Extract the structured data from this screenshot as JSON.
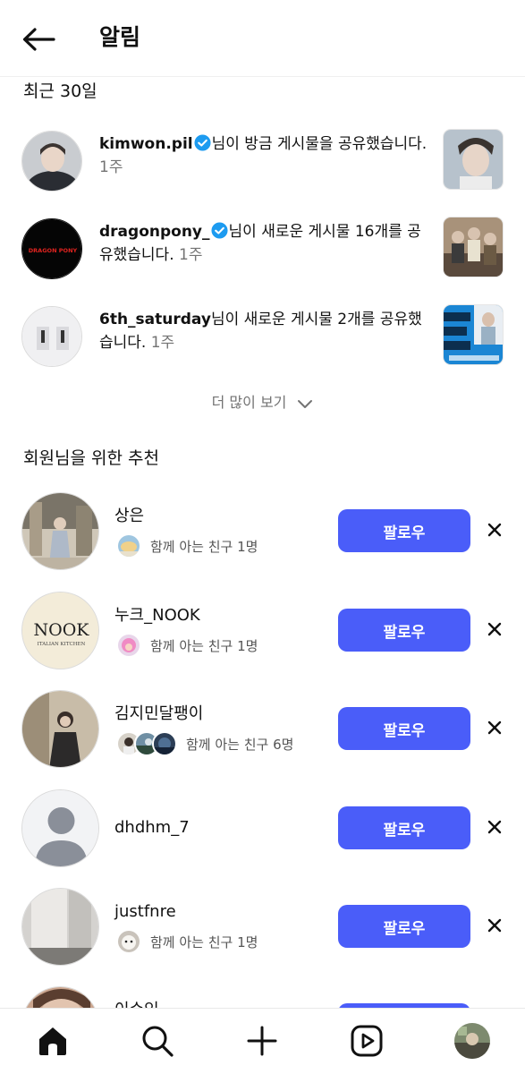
{
  "header": {
    "title": "알림",
    "back_icon": "arrow-left-icon"
  },
  "recent": {
    "heading": "최근 30일",
    "items": [
      {
        "username": "kimwon.pil",
        "verified": true,
        "message": "님이 방금 게시물을 공유했습니다.",
        "time": "1주"
      },
      {
        "username": "dragonpony_",
        "verified": true,
        "message": "님이 새로운 게시물 16개를 공유했습니다.",
        "time": "1주",
        "avatar_text": "DRAGON PONY"
      },
      {
        "username": "6th_saturday",
        "verified": false,
        "message": "님이 새로운 게시물 2개를 공유했습니다.",
        "time": "1주"
      }
    ],
    "see_more": "더 많이 보기"
  },
  "suggestions": {
    "heading": "회원님을 위한 추천",
    "follow_label": "팔로우",
    "items": [
      {
        "name": "상은",
        "mutual": "함께 아는 친구 1명"
      },
      {
        "name": "누크_NOOK",
        "mutual": "함께 아는 친구 1명",
        "avatar_logo": "NOOK",
        "avatar_sub": "ITALIAN KITCHEN"
      },
      {
        "name": "김지민달팽이",
        "mutual": "함께 아는 친구 6명"
      },
      {
        "name": "dhdhm_7",
        "mutual": ""
      },
      {
        "name": "justfnre",
        "mutual": "함께 아는 친구 1명"
      },
      {
        "name": "이수인",
        "mutual": ""
      }
    ]
  },
  "bottom_nav": {
    "items": [
      "home-icon",
      "search-icon",
      "plus-icon",
      "reels-icon",
      "profile-avatar"
    ]
  },
  "colors": {
    "accent": "#4a5df9",
    "verified": "#1d9bf0",
    "muted": "#737373"
  }
}
